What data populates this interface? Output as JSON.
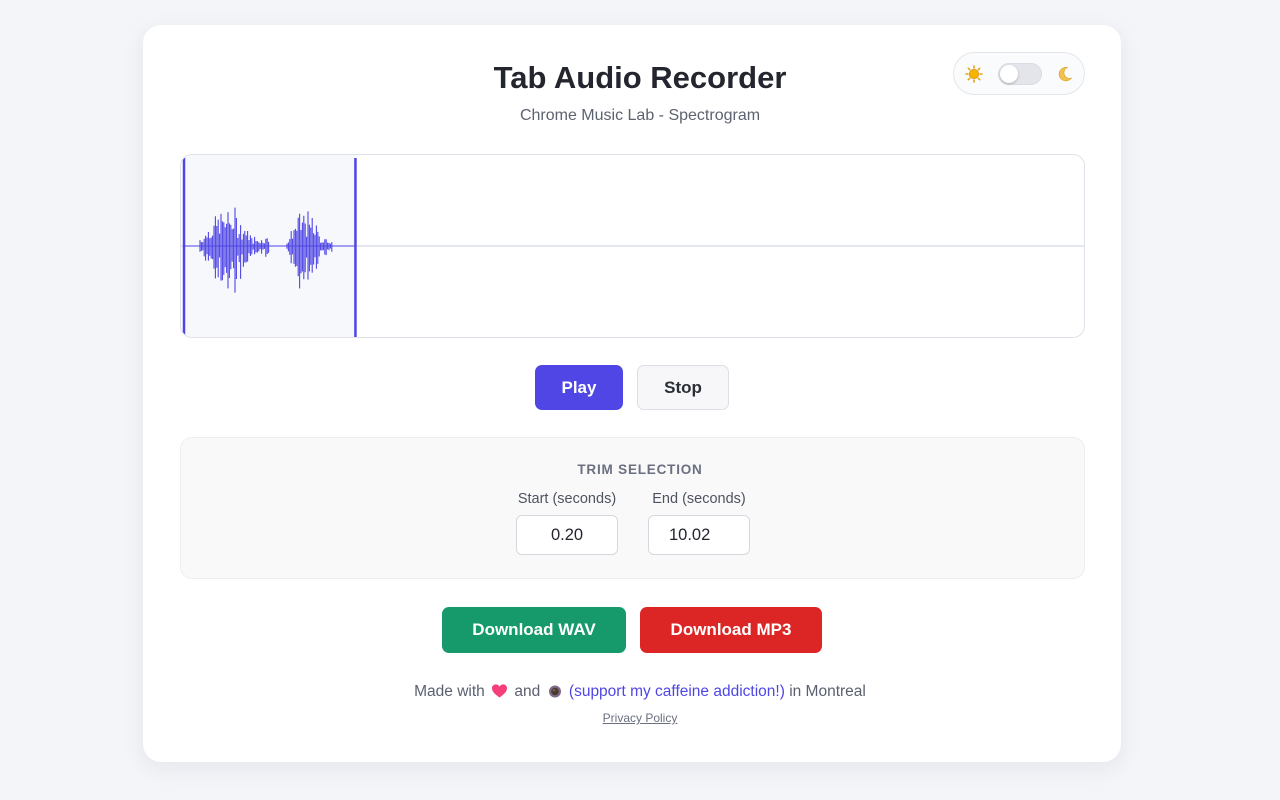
{
  "app": {
    "title": "Tab Audio Recorder",
    "subtitle": "Chrome Music Lab - Spectrogram"
  },
  "theme_toggle": {
    "light_icon": "sun-icon",
    "dark_icon": "moon-icon",
    "dark_mode_enabled": false
  },
  "waveform": {
    "color": "#4f46e5",
    "selection": {
      "start_fraction": 0.0,
      "end_fraction": 0.19
    }
  },
  "controls": {
    "play_label": "Play",
    "stop_label": "Stop"
  },
  "trim": {
    "heading": "TRIM SELECTION",
    "start_label": "Start (seconds)",
    "start_value": "0.20",
    "end_label": "End (seconds)",
    "end_value": "10.02"
  },
  "downloads": {
    "wav_label": "Download WAV",
    "mp3_label": "Download MP3"
  },
  "footer": {
    "made_with": "Made with",
    "heart_icon": "heart-icon",
    "and": "and",
    "coffee_icon": "coffee-icon",
    "support_link": "(support my caffeine addiction!)",
    "location": "in Montreal",
    "privacy_link": "Privacy Policy"
  },
  "colors": {
    "accent": "#4f46e5",
    "wav_green": "#169a6c",
    "mp3_red": "#dc2626"
  }
}
